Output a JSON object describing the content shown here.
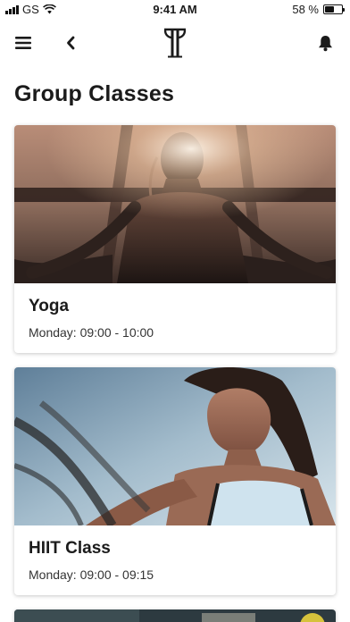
{
  "status_bar": {
    "carrier": "GS",
    "time": "9:41 AM",
    "battery_percent": "58 %",
    "battery_level": 0.58
  },
  "nav": {
    "left_icons": [
      "menu-icon",
      "back-icon"
    ],
    "logo": "brand-logo",
    "right_icons": [
      "bell-icon"
    ]
  },
  "page": {
    "title": "Group Classes"
  },
  "classes": [
    {
      "name": "Yoga",
      "schedule": "Monday: 09:00 - 10:00",
      "image": "yoga-photo"
    },
    {
      "name": "HIIT Class",
      "schedule": "Monday: 09:00 - 09:15",
      "image": "hiit-battle-ropes-photo"
    }
  ],
  "colors": {
    "text": "#1b1b1b",
    "background": "#ffffff"
  }
}
